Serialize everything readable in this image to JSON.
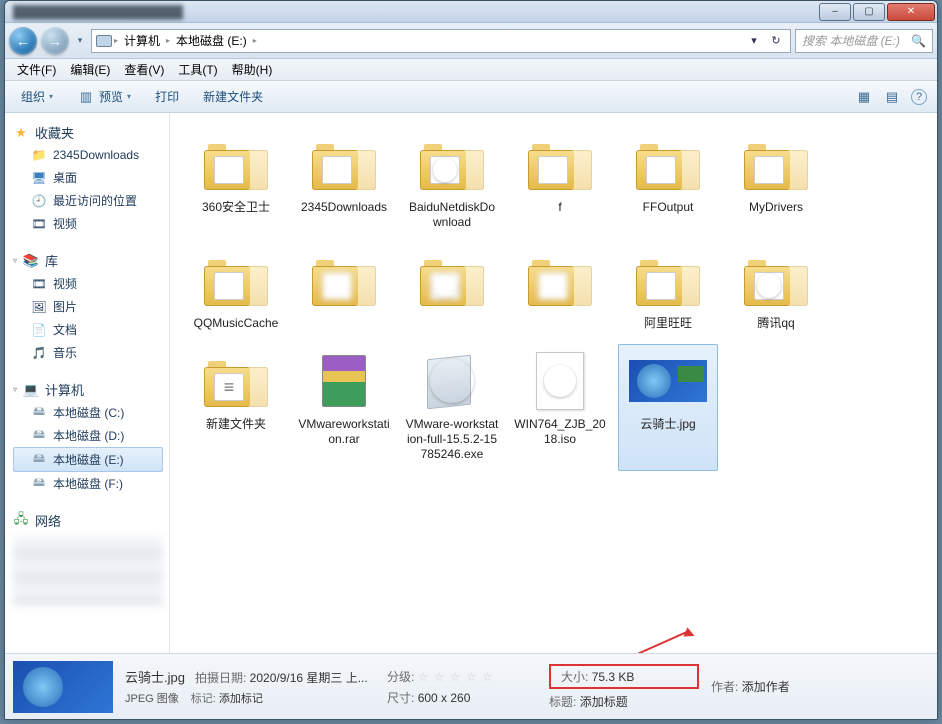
{
  "titlebar": {
    "title_blurred": ""
  },
  "win_controls": {
    "min": "–",
    "max": "▢",
    "close": "✕"
  },
  "navbar": {
    "back_glyph": "←",
    "fwd_glyph": "→",
    "dropdown_glyph": "▾",
    "refresh_glyph": "↻",
    "history_glyph": "▾"
  },
  "breadcrumbs": {
    "root_glyph": "🖴",
    "items": [
      "计算机",
      "本地磁盘 (E:)"
    ],
    "sep": "▸"
  },
  "searchbox": {
    "placeholder": "搜索 本地磁盘 (E:)",
    "icon": "🔍"
  },
  "menubar": {
    "items": [
      "文件(F)",
      "编辑(E)",
      "查看(V)",
      "工具(T)",
      "帮助(H)"
    ]
  },
  "toolbar": {
    "organize": "组织",
    "preview": "预览",
    "print": "打印",
    "new_folder": "新建文件夹",
    "drop": "▾",
    "view_icon": "▦",
    "help_icon": "?"
  },
  "sidebar": {
    "favorites": {
      "label": "收藏夹",
      "items": [
        "2345Downloads",
        "桌面",
        "最近访问的位置",
        "视频"
      ]
    },
    "libraries": {
      "label": "库",
      "items": [
        "视频",
        "图片",
        "文档",
        "音乐"
      ]
    },
    "computer": {
      "label": "计算机",
      "items": [
        "本地磁盘 (C:)",
        "本地磁盘 (D:)",
        "本地磁盘 (E:)",
        "本地磁盘 (F:)"
      ],
      "selected_index": 2
    },
    "network": {
      "label": "网络"
    }
  },
  "files": {
    "items": [
      {
        "name": "360安全卫士",
        "type": "folder"
      },
      {
        "name": "2345Downloads",
        "type": "folder"
      },
      {
        "name": "BaiduNetdiskDownload",
        "type": "folder",
        "disc": true
      },
      {
        "name": "f",
        "type": "folder"
      },
      {
        "name": "FFOutput",
        "type": "folder"
      },
      {
        "name": "MyDrivers",
        "type": "folder"
      },
      {
        "name": "QQMusicCache",
        "type": "folder"
      },
      {
        "name": "",
        "type": "folder",
        "blur": true
      },
      {
        "name": "",
        "type": "folder",
        "blur": true,
        "disc": true
      },
      {
        "name": "",
        "type": "folder",
        "blur": true
      },
      {
        "name": "阿里旺旺",
        "type": "folder"
      },
      {
        "name": "腾讯qq",
        "type": "folder",
        "disc": true
      },
      {
        "name": "新建文件夹",
        "type": "folder",
        "paper": true
      },
      {
        "name": "VMwareworkstation.rar",
        "type": "rar"
      },
      {
        "name": "VMware-workstation-full-15.5.2-15785246.exe",
        "type": "installer"
      },
      {
        "name": "WIN764_ZJB_2018.iso",
        "type": "iso"
      },
      {
        "name": "云骑士.jpg",
        "type": "jpg",
        "selected": true
      }
    ]
  },
  "details": {
    "filename": "云骑士.jpg",
    "filetype": "JPEG 图像",
    "shot_date_label": "拍摄日期:",
    "shot_date_value": "2020/9/16 星期三 上...",
    "tag_label": "标记:",
    "tag_value": "添加标记",
    "rating_label": "分级:",
    "rating_value": "☆ ☆ ☆ ☆ ☆",
    "dim_label": "尺寸:",
    "dim_value": "600 x 260",
    "size_label": "大小:",
    "size_value": "75.3 KB",
    "title_label": "标题:",
    "title_value": "添加标题",
    "author_label": "作者:",
    "author_value": "添加作者"
  }
}
